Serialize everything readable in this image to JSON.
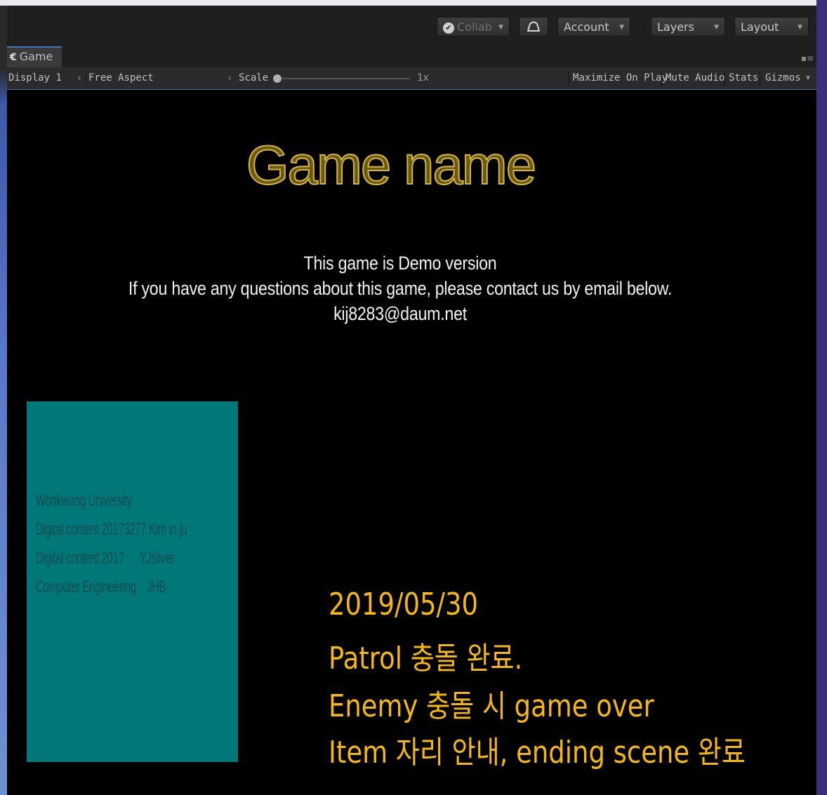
{
  "toolbar": {
    "collab_label": "Collab",
    "account_label": "Account",
    "layers_label": "Layers",
    "layout_label": "Layout"
  },
  "tabs": {
    "game_tab_label": "Game"
  },
  "game_controls": {
    "display": "Display 1",
    "aspect": "Free Aspect",
    "scale_label": "Scale",
    "scale_value": "1x",
    "maximize_label": "Maximize On Play",
    "mute_label": "Mute Audio",
    "stats_label": "Stats",
    "gizmos_label": "Gizmos"
  },
  "game_screen": {
    "title": "Game name",
    "info_lines": [
      "This game is Demo version",
      "If you have any questions about this game, please contact us by email below.",
      "kij8283@daum.net"
    ],
    "credits": [
      "Wonkwang University",
      "Digital content 20173277 Kim in ju",
      "Digital content 2017      YJsliver",
      "Computer Engineering    JHB"
    ],
    "notes": [
      "2019/05/30",
      "Patrol 충돌 완료.",
      "Enemy 충돌 시 game over",
      "Item 자리 안내, ending scene 완료"
    ]
  },
  "colors": {
    "title_outline": "#d7b640",
    "notes_text": "#f7b80c",
    "credits_panel": "#00787a",
    "tab_accent": "#3b78c8"
  }
}
